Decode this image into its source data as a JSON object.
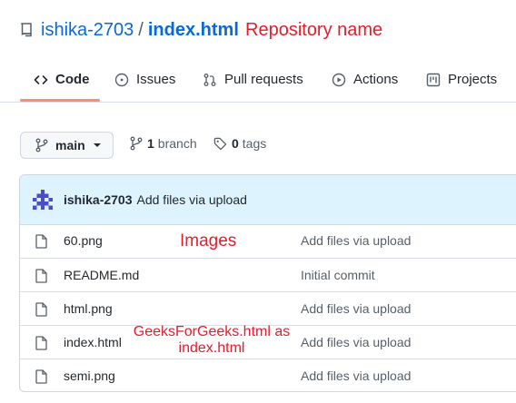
{
  "repo": {
    "owner": "ishika-2703",
    "separator": "/",
    "name": "index.html"
  },
  "annotations": {
    "repo": "Repository name",
    "images": "Images",
    "gfg_line1": "GeeksForGeeks.html as",
    "gfg_line2": "index.html"
  },
  "tabs": [
    {
      "label": "Code",
      "icon": "code-icon",
      "active": true
    },
    {
      "label": "Issues",
      "icon": "issue-icon"
    },
    {
      "label": "Pull requests",
      "icon": "pull-request-icon"
    },
    {
      "label": "Actions",
      "icon": "play-icon"
    },
    {
      "label": "Projects",
      "icon": "project-board-icon"
    }
  ],
  "branch": {
    "current": "main",
    "branch_count": "1",
    "branch_label": "branch",
    "tag_count": "0",
    "tag_label": "tags"
  },
  "commit": {
    "author": "ishika-2703",
    "message": "Add files via upload"
  },
  "files": [
    {
      "name": "60.png",
      "message": "Add files via upload"
    },
    {
      "name": "README.md",
      "message": "Initial commit"
    },
    {
      "name": "html.png",
      "message": "Add files via upload"
    },
    {
      "name": "index.html",
      "message": "Add files via upload"
    },
    {
      "name": "semi.png",
      "message": "Add files via upload"
    }
  ],
  "colors": {
    "link": "#0969da",
    "annotation": "#e81b2b",
    "active_tab_underline": "#fd8c73",
    "commit_bar": "#ddf4ff"
  }
}
